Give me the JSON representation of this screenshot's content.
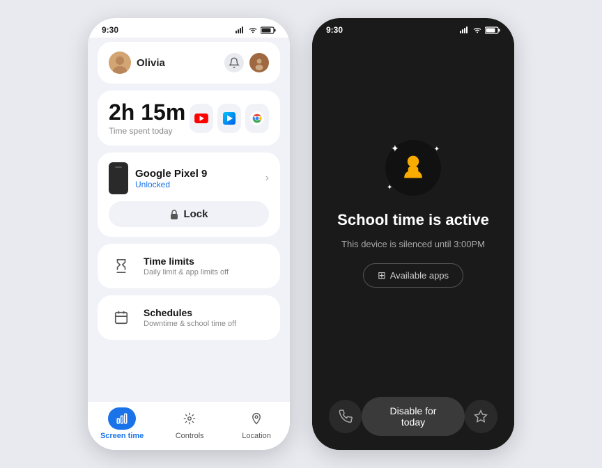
{
  "phone1": {
    "status_bar": {
      "time": "9:30"
    },
    "header": {
      "user_name": "Olivia"
    },
    "time_section": {
      "time_spent": "2h 15m",
      "time_label": "Time spent today"
    },
    "device_section": {
      "device_name": "Google Pixel 9",
      "device_status": "Unlocked",
      "lock_label": "Lock"
    },
    "time_limits": {
      "title": "Time limits",
      "subtitle": "Daily limit & app limits off"
    },
    "schedules": {
      "title": "Schedules",
      "subtitle": "Downtime & school time off"
    },
    "bottom_nav": {
      "screen_time": "Screen time",
      "controls": "Controls",
      "location": "Location"
    }
  },
  "phone2": {
    "status_bar": {
      "time": "9:30"
    },
    "school_title": "School time is active",
    "school_subtitle": "This device is silenced until 3:00PM",
    "available_apps_btn": "Available apps",
    "disable_btn": "Disable for today"
  }
}
